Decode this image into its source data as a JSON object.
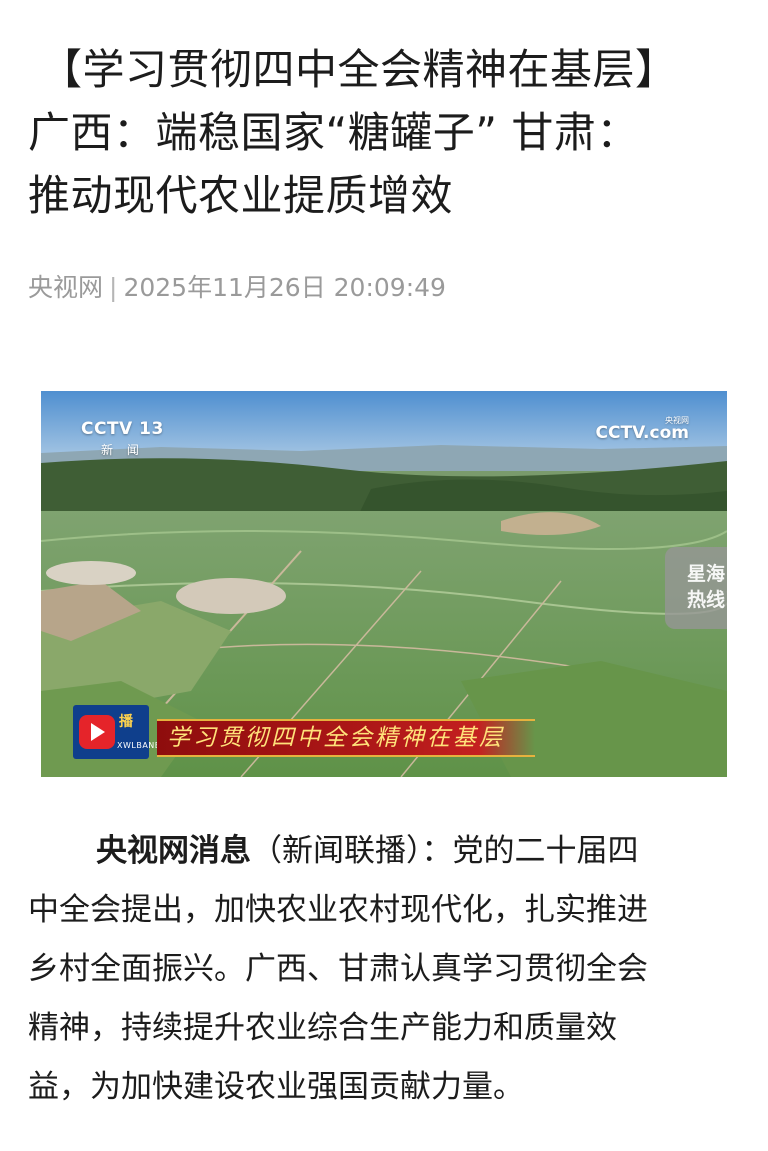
{
  "article": {
    "title_lines": [
      "【学习贯彻四中全会精神在基层】",
      "广西：端稳国家“糖罐子” 甘肃：",
      "推动现代农业提质增效"
    ],
    "source": "央视网",
    "separator": "|",
    "datetime": "2025年11月26日 20:09:49"
  },
  "video": {
    "channel_logo": "CCTV 13",
    "channel_sub": "新 闻",
    "site_logo": "CCTV.com",
    "site_logo_small": "央视网",
    "hotline_label": [
      "星海",
      "热线"
    ],
    "program_logo_text": "播",
    "program_logo_en": "XWLBANBO",
    "banner_text": "学习贯彻四中全会精神在基层"
  },
  "body": {
    "lead": "央视网消息",
    "paren": "（新闻联播）：党的二十届四",
    "lines": [
      "中全会提出，加快农业农村现代化，扎实推进",
      "乡村全面振兴。广西、甘肃认真学习贯彻全会",
      "精神，持续提升农业综合生产能力和质量效",
      "益，为加快建设农业强国贡献力量。"
    ]
  },
  "colors": {
    "meta_gray": "#9a9a9a",
    "banner_red": "#b01818",
    "banner_text": "#ffe27a"
  }
}
